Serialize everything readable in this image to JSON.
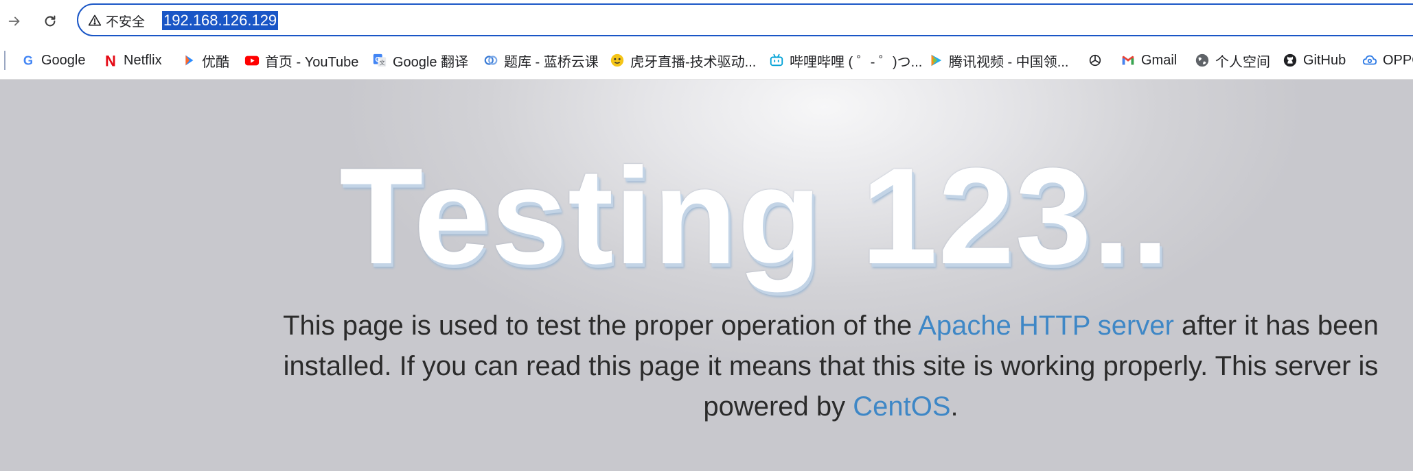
{
  "browser": {
    "security_label": "不安全",
    "url": "192.168.126.129"
  },
  "bookmarks": [
    {
      "label": "Google",
      "icon": "google-icon"
    },
    {
      "label": "Netflix",
      "icon": "netflix-icon"
    },
    {
      "label": "优酷",
      "icon": "youku-icon"
    },
    {
      "label": "首页 - YouTube",
      "icon": "youtube-icon"
    },
    {
      "label": "Google 翻译",
      "icon": "google-translate-icon"
    },
    {
      "label": "题库 - 蓝桥云课",
      "icon": "lanqiao-icon"
    },
    {
      "label": "虎牙直播-技术驱动...",
      "icon": "huya-icon"
    },
    {
      "label": "哔哩哔哩 ( ゜- ゜)つ...",
      "icon": "bilibili-icon"
    },
    {
      "label": "腾讯视频 - 中国领...",
      "icon": "tencent-video-icon"
    },
    {
      "label": "",
      "icon": "openai-icon"
    },
    {
      "label": "Gmail",
      "icon": "gmail-icon"
    },
    {
      "label": "个人空间",
      "icon": "globe-icon"
    },
    {
      "label": "GitHub",
      "icon": "github-icon"
    },
    {
      "label": "OPPO",
      "icon": "oppo-cloud-icon"
    }
  ],
  "page": {
    "headline": "Testing 123..",
    "description": {
      "part1": "This page is used to test the proper operation of the ",
      "link1": "Apache HTTP server",
      "part2": " after it has been installed. If you can read this page it means that this site is working properly. This server is powered by ",
      "link2": "CentOS",
      "part3": "."
    }
  },
  "colors": {
    "accent": "#1a56c6",
    "link": "#3e87c6"
  }
}
